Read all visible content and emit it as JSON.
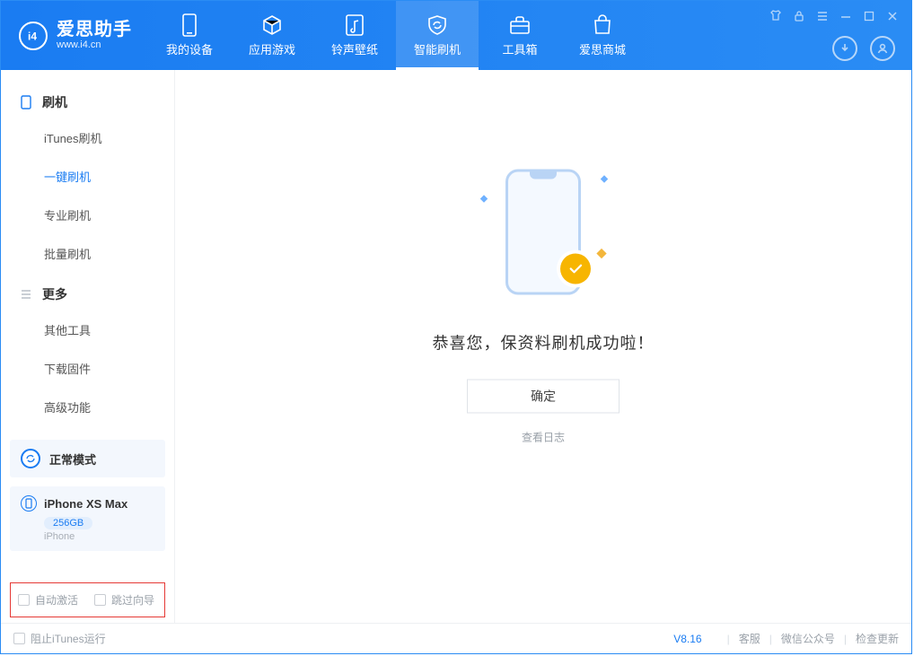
{
  "app": {
    "name_cn": "爱思助手",
    "name_en": "www.i4.cn"
  },
  "nav": {
    "tabs": [
      {
        "label": "我的设备"
      },
      {
        "label": "应用游戏"
      },
      {
        "label": "铃声壁纸"
      },
      {
        "label": "智能刷机"
      },
      {
        "label": "工具箱"
      },
      {
        "label": "爱思商城"
      }
    ]
  },
  "sidebar": {
    "group1_title": "刷机",
    "group1": [
      {
        "label": "iTunes刷机"
      },
      {
        "label": "一键刷机"
      },
      {
        "label": "专业刷机"
      },
      {
        "label": "批量刷机"
      }
    ],
    "group2_title": "更多",
    "group2": [
      {
        "label": "其他工具"
      },
      {
        "label": "下载固件"
      },
      {
        "label": "高级功能"
      }
    ]
  },
  "device": {
    "mode": "正常模式",
    "name": "iPhone XS Max",
    "capacity": "256GB",
    "type": "iPhone"
  },
  "options": {
    "auto_activate": "自动激活",
    "skip_guide": "跳过向导"
  },
  "main": {
    "message": "恭喜您，保资料刷机成功啦！",
    "ok": "确定",
    "view_log": "查看日志"
  },
  "footer": {
    "block_itunes": "阻止iTunes运行",
    "version": "V8.16",
    "links": [
      "客服",
      "微信公众号",
      "检查更新"
    ]
  }
}
